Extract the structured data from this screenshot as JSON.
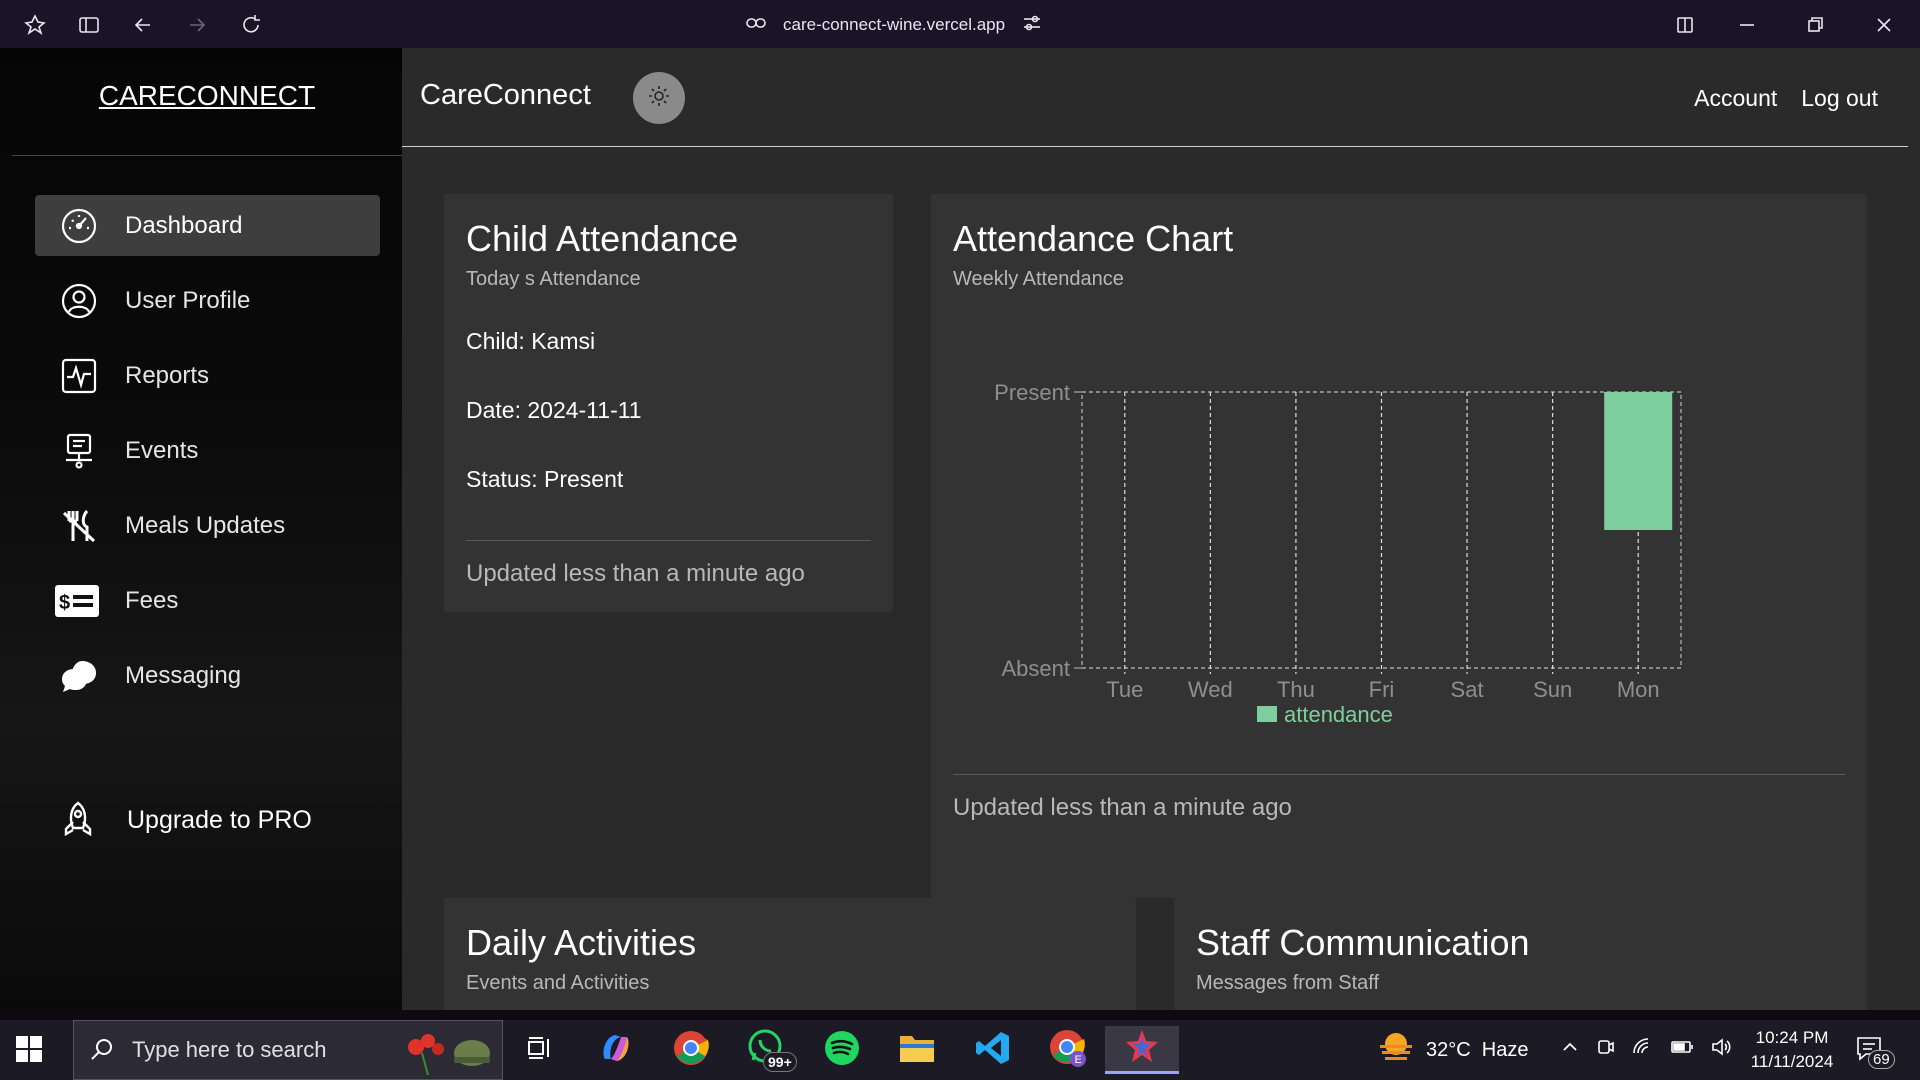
{
  "browser": {
    "url": "care-connect-wine.vercel.app"
  },
  "sidebar": {
    "brand": "CARECONNECT",
    "items": [
      {
        "label": "Dashboard",
        "icon": "gauge-icon",
        "active": true
      },
      {
        "label": "User Profile",
        "icon": "user-circle-icon"
      },
      {
        "label": "Reports",
        "icon": "activity-icon"
      },
      {
        "label": "Events",
        "icon": "presentation-icon"
      },
      {
        "label": "Meals Updates",
        "icon": "no-utensils-icon"
      },
      {
        "label": "Fees",
        "icon": "bill-icon"
      },
      {
        "label": "Messaging",
        "icon": "chat-bubble-icon"
      }
    ],
    "upgrade_label": "Upgrade to PRO"
  },
  "topbar": {
    "title": "CareConnect",
    "account": "Account",
    "logout": "Log out"
  },
  "attendance_card": {
    "title": "Child Attendance",
    "subtitle": "Today s Attendance",
    "child": "Child: Kamsi",
    "date": "Date: 2024-11-11",
    "status": "Status: Present",
    "footer": "Updated less than a minute ago"
  },
  "chart_card": {
    "title": "Attendance Chart",
    "subtitle": "Weekly Attendance",
    "footer": "Updated less than a minute ago"
  },
  "chart_data": {
    "type": "bar",
    "categories": [
      "Tue",
      "Wed",
      "Thu",
      "Fri",
      "Sat",
      "Sun",
      "Mon"
    ],
    "y_ticks": [
      "Absent",
      "Present"
    ],
    "series": [
      {
        "name": "attendance",
        "values": [
          0,
          0,
          0,
          0,
          0,
          0,
          1
        ],
        "color": "#7fcf9e"
      }
    ],
    "legend": "bottom-center",
    "grid": true,
    "ylim": [
      0,
      1
    ]
  },
  "activities_card": {
    "title": "Daily Activities",
    "subtitle": "Events and Activities"
  },
  "staff_card": {
    "title": "Staff Communication",
    "subtitle": "Messages from Staff"
  },
  "taskbar": {
    "search_placeholder": "Type here to search",
    "whatsapp_badge": "99+",
    "weather": "32°C  Haze",
    "time": "10:24 PM",
    "date": "11/11/2024",
    "notifications": "69"
  }
}
